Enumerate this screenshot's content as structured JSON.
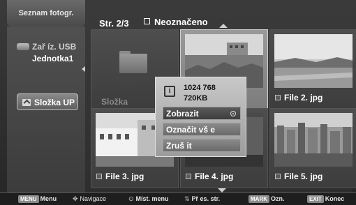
{
  "window": {
    "title": "Seznam fotogr."
  },
  "sidebar": {
    "device_label": "Zař íz. USB",
    "device_name": "Jednotka1",
    "folder_up_label": "Složka UP"
  },
  "header": {
    "page": "Str. 2/3",
    "marked_label": "Neoznačeno"
  },
  "tiles": [
    {
      "caption": "Složka",
      "type": "folder"
    },
    {
      "caption": "",
      "type": "image"
    },
    {
      "caption": "File 2. jpg",
      "type": "image"
    },
    {
      "caption": "File 3. jpg",
      "type": "image"
    },
    {
      "caption": "File 4. jpg",
      "type": "image"
    },
    {
      "caption": "File 5. jpg",
      "type": "image"
    }
  ],
  "popup": {
    "resolution": "1024 768",
    "size": "720KB",
    "items": [
      "Zobrazit",
      "Označit vš e",
      "Zruš it"
    ]
  },
  "bottom": {
    "menu_key": "MENU",
    "menu_label": "Menu",
    "nav_label": "Navigace",
    "ok_label": "Míst. menu",
    "pr_label": "Př es. str.",
    "mark_key": "MARK",
    "mark_label": "Ozn.",
    "exit_key": "EXIT",
    "exit_label": "Konec"
  },
  "colors": {
    "background": "#2a2a2a",
    "panel": "#4a4a4a",
    "selected": "#8a8a8a",
    "text": "#ffffff"
  }
}
